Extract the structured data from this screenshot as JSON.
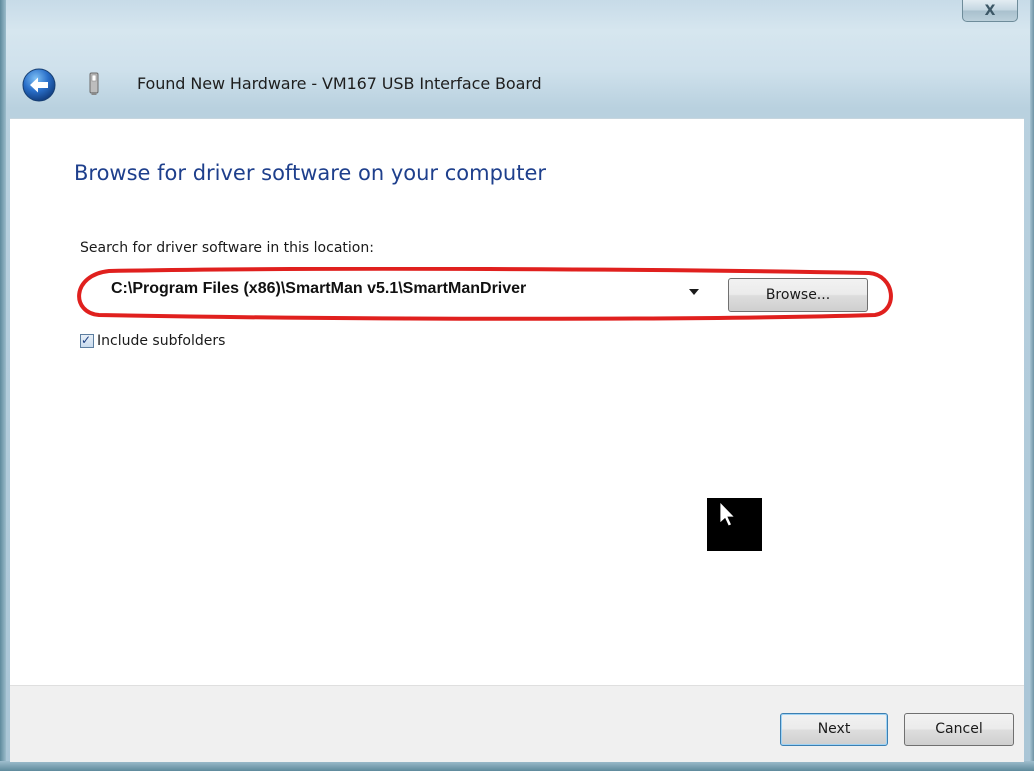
{
  "window": {
    "title": "Found New Hardware - VM167 USB Interface Board",
    "close_glyph": "X"
  },
  "content": {
    "heading": "Browse for driver software on your computer",
    "search_label": "Search for driver software in this location:",
    "path_value": "C:\\Program Files (x86)\\SmartMan v5.1\\SmartManDriver",
    "browse_label": "Browse...",
    "include_subfolders_label": "Include subfolders",
    "include_subfolders_checked": true
  },
  "footer": {
    "next_label": "Next",
    "cancel_label": "Cancel"
  },
  "icons": {
    "back": "back-arrow-icon",
    "device": "usb-device-icon",
    "close": "close-icon",
    "dropdown": "chevron-down-icon",
    "checkbox": "checkmark-icon",
    "cursor": "mouse-pointer-icon"
  },
  "colors": {
    "heading": "#1e3f8c",
    "highlight_ring": "#e0201e",
    "back_button": "#2a6fc9",
    "frame": "#a9c5d6"
  }
}
